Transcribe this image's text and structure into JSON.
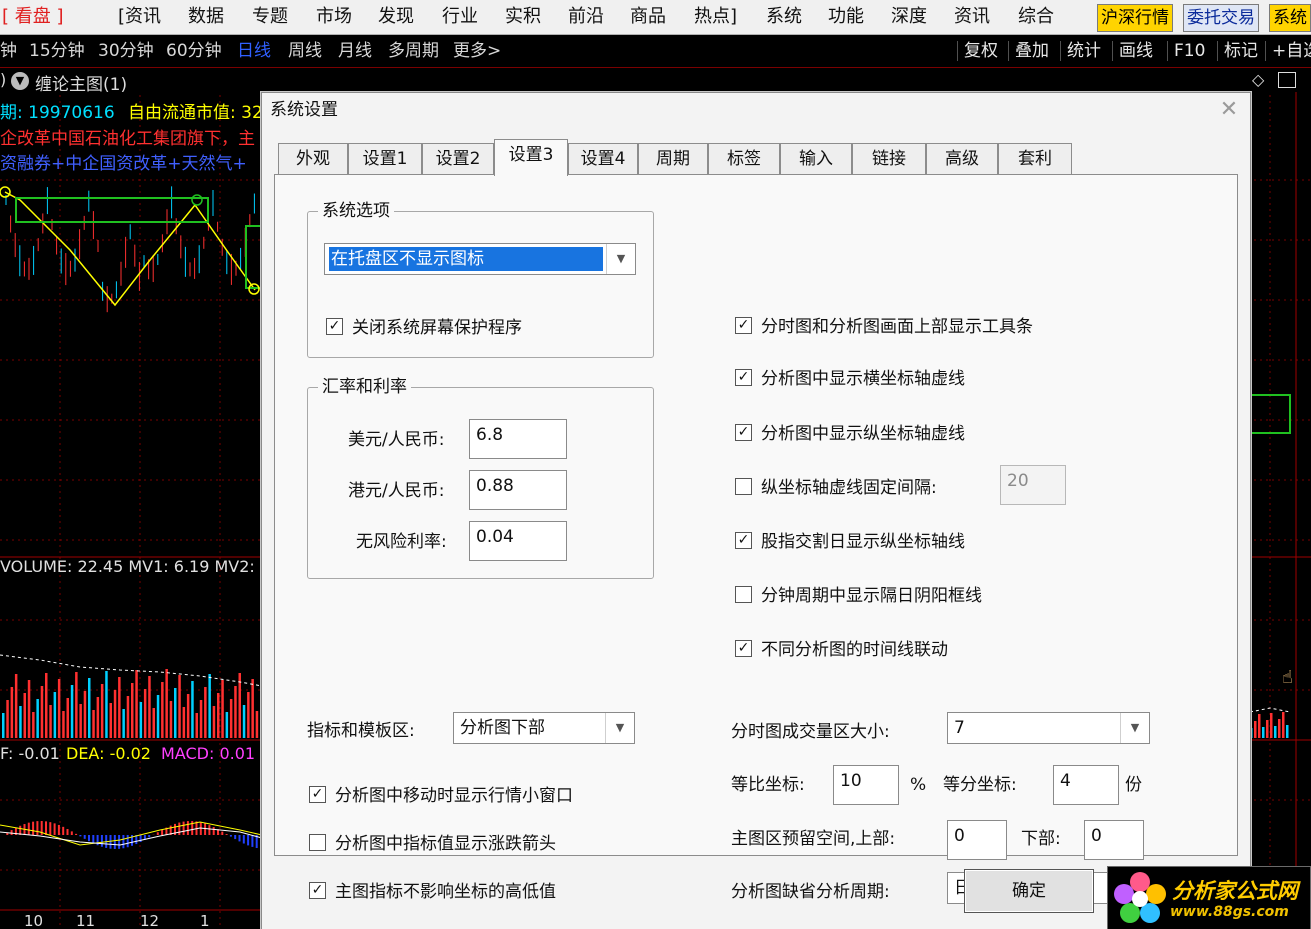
{
  "menubar": {
    "items": [
      "[ 看盘 ]",
      "[资讯",
      "数据",
      "专题",
      "市场",
      "发现",
      "行业",
      "实积",
      "前沿",
      "商品",
      "热点]",
      "系统",
      "功能",
      "深度",
      "资讯",
      "综合"
    ],
    "active_index": 0,
    "right_buttons": [
      "沪深行情",
      "委托交易",
      "系统"
    ]
  },
  "toolbar": {
    "periods": [
      "钟",
      "15分钟",
      "30分钟",
      "60分钟",
      "日线",
      "周线",
      "月线",
      "多周期",
      "更多>"
    ],
    "active_period": "日线",
    "right_tools": [
      "复权",
      "叠加",
      "统计",
      "画线",
      "F10",
      "标记",
      "+自选"
    ]
  },
  "chart": {
    "title": "缠论主图(1)",
    "date_label": "期: 19970616",
    "float_mv_label": "自由流通市值: 32",
    "news_line1": "企改革中国石油化工集团旗下，主",
    "news_line2": "资融券+中企国资改革+天然气+",
    "volume_label": "VOLUME: 22.45 MV1: 6.19 MV2:",
    "macd_label_dif": "F: -0.01",
    "macd_label_dea": "DEA: -0.02",
    "macd_label_macd": "MACD: 0.01",
    "x_ticks": [
      "10",
      "11",
      "12",
      "1"
    ],
    "colors": {
      "up": "#ff3030",
      "down": "#00d0ff",
      "line_yellow": "#ffff00",
      "box_green": "#20c020"
    }
  },
  "dialog": {
    "title": "系统设置",
    "close_glyph": "✕",
    "tabs": [
      "外观",
      "设置1",
      "设置2",
      "设置3",
      "设置4",
      "周期",
      "标签",
      "输入",
      "链接",
      "高级",
      "套利"
    ],
    "active_tab": "设置3",
    "system_options": {
      "title": "系统选项",
      "tray_combo_value": "在托盘区不显示图标",
      "screensaver_checkbox": {
        "label": "关闭系统屏幕保护程序",
        "checked": true
      }
    },
    "rates": {
      "title": "汇率和利率",
      "usd_label": "美元/人民币:",
      "usd_value": "6.8",
      "hkd_label": "港元/人民币:",
      "hkd_value": "0.88",
      "riskfree_label": "无风险利率:",
      "riskfree_value": "0.04"
    },
    "template_area": {
      "label": "指标和模板区:",
      "value": "分析图下部"
    },
    "left_checks": [
      {
        "label": "分析图中移动时显示行情小窗口",
        "checked": true
      },
      {
        "label": "分析图中指标值显示涨跌箭头",
        "checked": false
      },
      {
        "label": "主图指标不影响坐标的高低值",
        "checked": true
      }
    ],
    "right_checks": [
      {
        "label": "分时图和分析图画面上部显示工具条",
        "checked": true
      },
      {
        "label": "分析图中显示横坐标轴虚线",
        "checked": true
      },
      {
        "label": "分析图中显示纵坐标轴虚线",
        "checked": true
      },
      {
        "label": "纵坐标轴虚线固定间隔:",
        "checked": false
      },
      {
        "label": "股指交割日显示纵坐标轴线",
        "checked": true
      },
      {
        "label": "分钟周期中显示隔日阴阳框线",
        "checked": false
      },
      {
        "label": "不同分析图的时间线联动",
        "checked": true
      }
    ],
    "fixed_interval_value": "20",
    "volume_area": {
      "label": "分时图成交量区大小:",
      "value": "7"
    },
    "ratio_axis": {
      "label": "等比坐标:",
      "value": "10",
      "unit": "%"
    },
    "equal_axis": {
      "label": "等分坐标:",
      "value": "4",
      "unit": "份"
    },
    "reserve_space": {
      "label": "主图区预留空间,上部:",
      "top_value": "0",
      "bottom_label": "下部:",
      "bottom_value": "0"
    },
    "default_period": {
      "label": "分析图缺省分析周期:",
      "value": "日线"
    },
    "ok_label": "确定",
    "combo_arrow": "▼",
    "check_glyph": "✓"
  },
  "watermark": {
    "line1": "分析家公式网",
    "line2": "www.88gs.com"
  }
}
